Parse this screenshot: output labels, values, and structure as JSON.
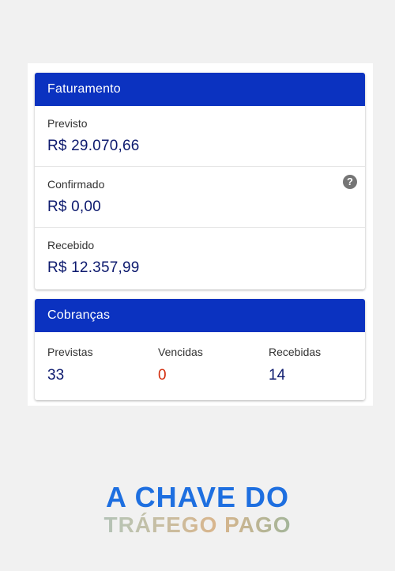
{
  "colors": {
    "header_bg": "#0b32c0",
    "value_blue": "#0d1a6e",
    "value_red": "#d32f0f",
    "brand_blue": "#1e6fe0"
  },
  "billing": {
    "title": "Faturamento",
    "rows": [
      {
        "label": "Previsto",
        "value": "R$ 29.070,66"
      },
      {
        "label": "Confirmado",
        "value": "R$ 0,00",
        "icon": "help-icon",
        "icon_glyph": "?"
      },
      {
        "label": "Recebido",
        "value": "R$ 12.357,99"
      }
    ]
  },
  "charges": {
    "title": "Cobranças",
    "stats": [
      {
        "label": "Previstas",
        "value": "33"
      },
      {
        "label": "Vencidas",
        "value": "0"
      },
      {
        "label": "Recebidas",
        "value": "14"
      }
    ]
  },
  "brand": {
    "line1": "A CHAVE DO",
    "line2": "TRÁFEGO PAGO"
  }
}
